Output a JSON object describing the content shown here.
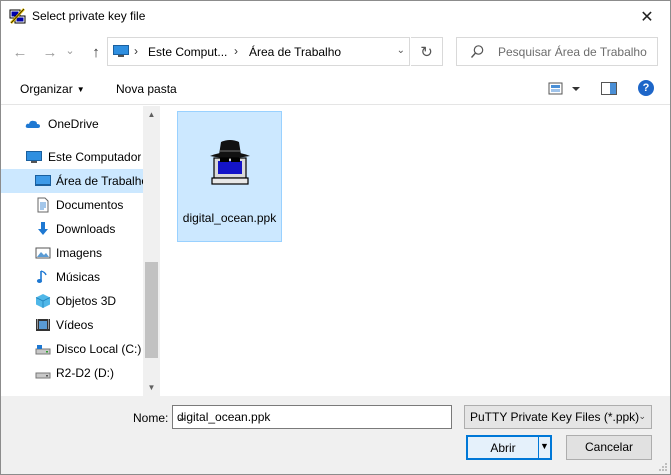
{
  "window": {
    "title": "Select private key file",
    "close_glyph": "✕"
  },
  "nav": {
    "back_glyph": "←",
    "forward_glyph": "→",
    "recent_glyph": "⌄",
    "up_glyph": "↑",
    "breadcrumbs": [
      "Este Comput...",
      "Área de Trabalho"
    ],
    "crumb_sep": "›",
    "refresh_glyph": "↻",
    "search_placeholder": "Pesquisar Área de Trabalho"
  },
  "toolbar": {
    "organize_label": "Organizar",
    "organize_caret": "▼",
    "new_folder_label": "Nova pasta",
    "help_glyph": "?"
  },
  "sidebar": {
    "items": [
      {
        "label": "OneDrive",
        "icon": "cloud-icon",
        "selected": false
      },
      {
        "label": "Este Computador",
        "icon": "computer-icon",
        "selected": false
      },
      {
        "label": "Área de Trabalho",
        "icon": "desktop-icon",
        "selected": true
      },
      {
        "label": "Documentos",
        "icon": "documents-icon",
        "selected": false
      },
      {
        "label": "Downloads",
        "icon": "downloads-icon",
        "selected": false
      },
      {
        "label": "Imagens",
        "icon": "pictures-icon",
        "selected": false
      },
      {
        "label": "Músicas",
        "icon": "music-icon",
        "selected": false
      },
      {
        "label": "Objetos 3D",
        "icon": "objects-3d-icon",
        "selected": false
      },
      {
        "label": "Vídeos",
        "icon": "videos-icon",
        "selected": false
      },
      {
        "label": "Disco Local (C:)",
        "icon": "drive-icon",
        "selected": false
      },
      {
        "label": "R2-D2 (D:)",
        "icon": "drive-icon",
        "selected": false
      }
    ],
    "scroll_up_glyph": "▲",
    "scroll_down_glyph": "▼"
  },
  "files": [
    {
      "name": "digital_ocean.ppk",
      "icon": "putty-key-icon",
      "selected": true
    }
  ],
  "footer": {
    "name_label": "Nome:",
    "name_value": "digital_ocean.ppk",
    "dropdown_glyph": "⌄",
    "filter_value": "PuTTY Private Key Files (*.ppk)",
    "open_label": "Abrir",
    "cancel_label": "Cancelar"
  },
  "colors": {
    "selection_bg": "#cce8ff",
    "accent": "#0078d7",
    "footer_bg": "#f0f0f0"
  }
}
